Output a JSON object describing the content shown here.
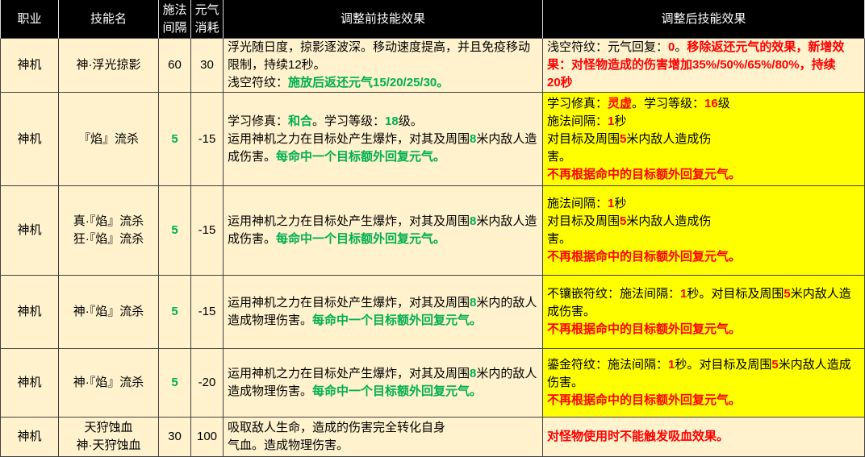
{
  "colors": {
    "header_bg": "#000000",
    "header_text": "#FFFFFF",
    "header_divider": "#D9D9D9",
    "body_bg": "#FFF2CC",
    "highlight_bg": "#FFFF00",
    "grid_line": "#404040",
    "text": "#000000",
    "green": "#00B050",
    "red": "#FF0000"
  },
  "headers": {
    "job": "职业",
    "skill": "技能名",
    "cast_interval": "施法\n间隔",
    "energy_cost": "元气\n消耗",
    "before": "调整前技能效果",
    "after": "调整后技能效果"
  },
  "rows": [
    {
      "job": "神机",
      "skill": "神·浮光掠影",
      "cast_interval": {
        "text": "60"
      },
      "energy_cost": "30",
      "before": [
        [
          {
            "text": "浮光随日度，掠影逐波深。移动速度提高，并且免疫移动"
          }
        ],
        [
          {
            "text": "限制，持续12秒。"
          }
        ],
        [
          {
            "text": "浅空符纹："
          },
          {
            "text": "施放后返还元气15/20/25/30。",
            "color": "#00B050",
            "bold": true
          }
        ]
      ],
      "after_bg": "#FFF2CC",
      "after": [
        [
          {
            "text": "浅空符纹：元气回复："
          },
          {
            "text": "0",
            "color": "#FF0000",
            "bold": true
          },
          {
            "text": "。"
          },
          {
            "text": "移除返还元气的效果，新增效",
            "color": "#FF0000",
            "bold": true
          }
        ],
        [
          {
            "text": "果：对怪物造成的伤害增加35%/50%/65%/80%，持续",
            "color": "#FF0000",
            "bold": true
          }
        ],
        [
          {
            "text": "20秒",
            "color": "#FF0000",
            "bold": true
          }
        ]
      ]
    },
    {
      "job": "神机",
      "skill": "『焰』流杀",
      "cast_interval": {
        "text": "5",
        "color": "#00B050",
        "bold": true
      },
      "energy_cost": "-15",
      "before": [
        [
          {
            "text": "学习修真："
          },
          {
            "text": "和合",
            "color": "#00B050",
            "bold": true
          },
          {
            "text": "。学习等级："
          },
          {
            "text": "18",
            "color": "#00B050",
            "bold": true
          },
          {
            "text": "级。"
          }
        ],
        [
          {
            "text": "运用神机之力在目标处产生爆炸，对其及周围"
          },
          {
            "text": "8",
            "color": "#00B050",
            "bold": true
          },
          {
            "text": "米内敌人造"
          }
        ],
        [
          {
            "text": "成伤害。"
          },
          {
            "text": "每命中一个目标额外回复元气。",
            "color": "#00B050",
            "bold": true
          }
        ]
      ],
      "after_bg": "#FFFF00",
      "after": [
        [
          {
            "text": "学习修真："
          },
          {
            "text": "灵虚",
            "color": "#FF0000",
            "bold": true
          },
          {
            "text": "。学习等级："
          },
          {
            "text": "16",
            "color": "#FF0000",
            "bold": true
          },
          {
            "text": "级"
          }
        ],
        [
          {
            "text": "施法间隔："
          },
          {
            "text": "1",
            "color": "#FF0000",
            "bold": true
          },
          {
            "text": "秒"
          }
        ],
        [
          {
            "text": "对目标及周围"
          },
          {
            "text": "5",
            "color": "#FF0000",
            "bold": true
          },
          {
            "text": "米内敌人造成伤"
          }
        ],
        [
          {
            "text": "害。"
          }
        ],
        [
          {
            "text": "不再根据命中的目标额外回复元气。",
            "color": "#FF0000",
            "bold": true
          }
        ]
      ]
    },
    {
      "job": "神机",
      "skill": "真·『焰』流杀\n狂·『焰』流杀",
      "cast_interval": {
        "text": "5",
        "color": "#00B050",
        "bold": true
      },
      "energy_cost": "-15",
      "before": [
        [
          {
            "text": "运用神机之力在目标处产生爆炸，对其及周围"
          },
          {
            "text": "8",
            "color": "#00B050",
            "bold": true
          },
          {
            "text": "米内敌人造"
          }
        ],
        [
          {
            "text": "成伤害。"
          },
          {
            "text": "每命中一个目标额外回复元气。",
            "color": "#00B050",
            "bold": true
          }
        ]
      ],
      "after_bg": "#FFFF00",
      "after": [
        [
          {
            "text": "施法间隔："
          },
          {
            "text": "1",
            "color": "#FF0000",
            "bold": true
          },
          {
            "text": "秒"
          }
        ],
        [
          {
            "text": "对目标及周围"
          },
          {
            "text": "5",
            "color": "#FF0000",
            "bold": true
          },
          {
            "text": "米内敌人造成伤"
          }
        ],
        [
          {
            "text": "害。"
          }
        ],
        [
          {
            "text": "不再根据命中的目标额外回复元气。",
            "color": "#FF0000",
            "bold": true
          }
        ]
      ]
    },
    {
      "job": "神机",
      "skill": "神·『焰』流杀",
      "cast_interval": {
        "text": "5",
        "color": "#00B050",
        "bold": true
      },
      "energy_cost": "-15",
      "before": [
        [
          {
            "text": "运用神机之力在目标处产生爆炸，对其及周围"
          },
          {
            "text": "8",
            "color": "#00B050",
            "bold": true
          },
          {
            "text": "米内的敌人"
          }
        ],
        [
          {
            "text": "造成物理伤害。"
          },
          {
            "text": "每命中一个目标额外回复元气。",
            "color": "#00B050",
            "bold": true
          }
        ]
      ],
      "after_bg": "#FFFF00",
      "after": [
        [
          {
            "text": "不镶嵌符纹：施法间隔："
          },
          {
            "text": "1",
            "color": "#FF0000",
            "bold": true
          },
          {
            "text": "秒。对目标及周围"
          },
          {
            "text": "5",
            "color": "#FF0000",
            "bold": true
          },
          {
            "text": "米内敌人造"
          }
        ],
        [
          {
            "text": "成伤害。"
          }
        ],
        [
          {
            "text": "不再根据命中的目标额外回复元气。",
            "color": "#FF0000",
            "bold": true
          }
        ]
      ]
    },
    {
      "job": "神机",
      "skill": "神·『焰』流杀",
      "cast_interval": {
        "text": "5",
        "color": "#00B050",
        "bold": true
      },
      "energy_cost": "-20",
      "before": [
        [
          {
            "text": "运用神机之力在目标处产生爆炸，对其及周围"
          },
          {
            "text": "8",
            "color": "#00B050",
            "bold": true
          },
          {
            "text": "米内的敌人"
          }
        ],
        [
          {
            "text": "造成物理伤害。"
          },
          {
            "text": "每命中一个目标额外回复元气。",
            "color": "#00B050",
            "bold": true
          }
        ]
      ],
      "after_bg": "#FFFF00",
      "after": [
        [
          {
            "text": "鎏金符纹：施法间隔："
          },
          {
            "text": "1",
            "color": "#FF0000",
            "bold": true
          },
          {
            "text": "秒。对目标及周围"
          },
          {
            "text": "5",
            "color": "#FF0000",
            "bold": true
          },
          {
            "text": "米内敌人造成"
          }
        ],
        [
          {
            "text": "伤害。"
          }
        ],
        [
          {
            "text": "不再根据命中的目标额外回复元气。",
            "color": "#FF0000",
            "bold": true
          }
        ]
      ]
    },
    {
      "job": "神机",
      "skill": "天狩蚀血\n神·天狩蚀血",
      "cast_interval": {
        "text": "30"
      },
      "energy_cost": "100",
      "before": [
        [
          {
            "text": "吸取敌人生命，造成的伤害完全转化自身"
          }
        ],
        [
          {
            "text": "气血。造成物理伤害。"
          }
        ]
      ],
      "after_bg": "#FFF2CC",
      "after": [
        [
          {
            "text": "对怪物使用时不能触发吸血效果。",
            "color": "#FF0000",
            "bold": true
          }
        ]
      ]
    }
  ]
}
